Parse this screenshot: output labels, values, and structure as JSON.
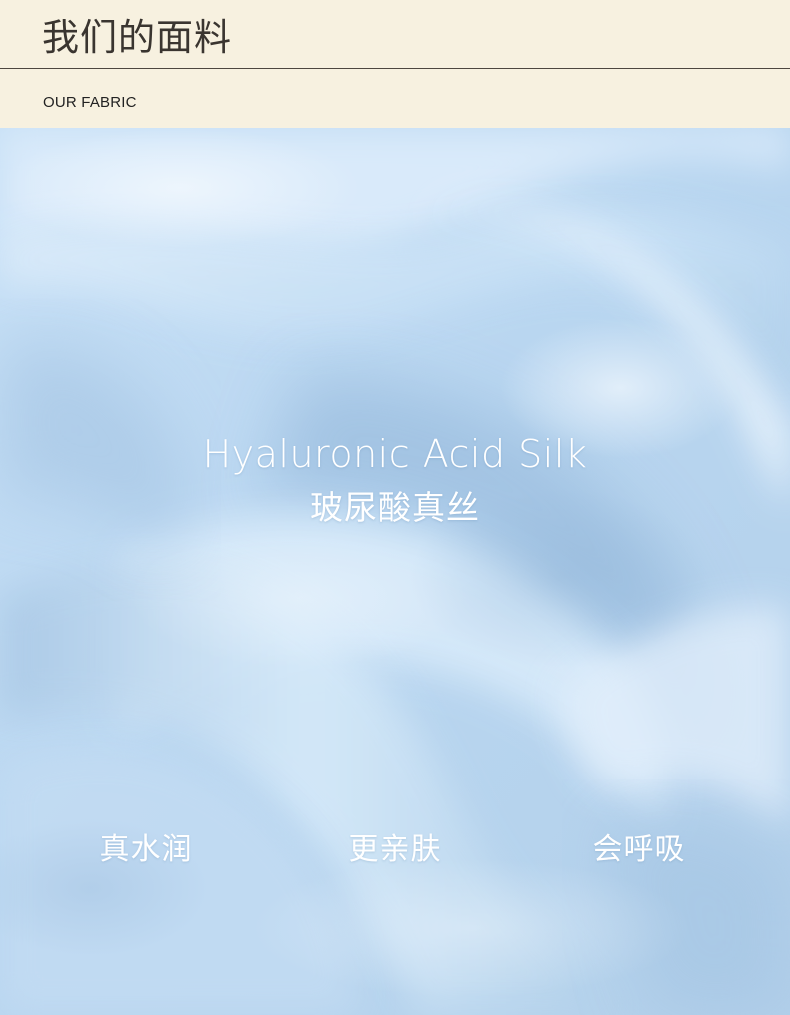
{
  "header": {
    "title_cn": "我们的面料",
    "title_en": "OUR FABRIC"
  },
  "product": {
    "name_en": "Hyaluronic Acid Silk",
    "name_cn": "玻尿酸真丝"
  },
  "features": [
    {
      "label": "真水润"
    },
    {
      "label": "更亲肤"
    },
    {
      "label": "会呼吸"
    }
  ],
  "colors": {
    "header_bg": "#f7f1e0",
    "fabric_blue": "#bcd8f0",
    "text_dark": "#3a3530",
    "text_white": "#ffffff"
  }
}
